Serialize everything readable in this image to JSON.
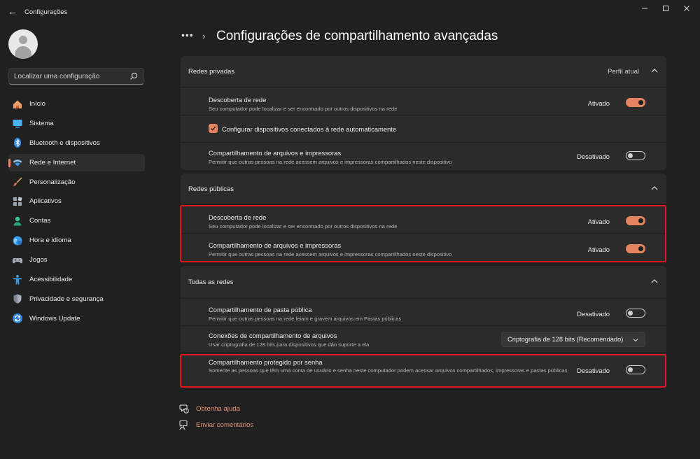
{
  "window": {
    "title": "Configurações",
    "back_label": "←",
    "controls": [
      "minimize",
      "maximize",
      "close"
    ]
  },
  "search": {
    "placeholder": "Localizar uma configuração"
  },
  "sidebar": {
    "items": [
      {
        "label": "Início",
        "icon": "home-icon"
      },
      {
        "label": "Sistema",
        "icon": "system-icon"
      },
      {
        "label": "Bluetooth e dispositivos",
        "icon": "bluetooth-icon"
      },
      {
        "label": "Rede e Internet",
        "icon": "wifi-icon",
        "active": true
      },
      {
        "label": "Personalização",
        "icon": "brush-icon"
      },
      {
        "label": "Aplicativos",
        "icon": "apps-icon"
      },
      {
        "label": "Contas",
        "icon": "account-icon"
      },
      {
        "label": "Hora e idioma",
        "icon": "globe-icon"
      },
      {
        "label": "Jogos",
        "icon": "gamepad-icon"
      },
      {
        "label": "Acessibilidade",
        "icon": "accessibility-icon"
      },
      {
        "label": "Privacidade e segurança",
        "icon": "shield-icon"
      },
      {
        "label": "Windows Update",
        "icon": "update-icon"
      }
    ]
  },
  "header": {
    "dots": "•••",
    "chevron": "›",
    "title": "Configurações de compartilhamento avançadas"
  },
  "private_networks": {
    "title": "Redes privadas",
    "profile": "Perfil atual",
    "network_discovery": {
      "title": "Descoberta de rede",
      "desc": "Seu computador pode localizar e ser encontrado por outros dispositivos na rede",
      "status": "Ativado"
    },
    "auto_setup": {
      "label": "Configurar dispositivos conectados à rede automaticamente",
      "checked": true
    },
    "file_printer_sharing": {
      "title": "Compartilhamento de arquivos e impressoras",
      "desc": "Permitir que outras pessoas na rede acessem arquivos e impressoras compartilhados neste dispositivo",
      "status": "Desativado"
    }
  },
  "public_networks": {
    "title": "Redes públicas",
    "network_discovery": {
      "title": "Descoberta de rede",
      "desc": "Seu computador pode localizar e ser encontrado por outros dispositivos na rede",
      "status": "Ativado"
    },
    "file_printer_sharing": {
      "title": "Compartilhamento de arquivos e impressoras",
      "desc": "Permitir que outras pessoas na rede acessem arquivos e impressoras compartilhados neste dispositivo",
      "status": "Ativado"
    }
  },
  "all_networks": {
    "title": "Todas as redes",
    "public_folder": {
      "title": "Compartilhamento de pasta pública",
      "desc": "Permitir que outras pessoas na rede leiam e gravem arquivos em Pastas públicas",
      "status": "Desativado"
    },
    "file_connections": {
      "title": "Conexões de compartilhamento de arquivos",
      "desc": "Usar criptografia de 128 bits para dispositivos que dão suporte a ela",
      "selected": "Criptografia de 128 bits (Recomendado)"
    },
    "password_protected": {
      "title": "Compartilhamento protegido por senha",
      "desc": "Somente as pessoas que têm uma conta de usuário e senha neste computador podem acessar arquivos compartilhados, impressoras e pastas públicas",
      "status": "Desativado"
    }
  },
  "footer": {
    "help": "Obtenha ajuda",
    "feedback": "Enviar comentários"
  },
  "colors": {
    "accent": "#e4835f",
    "link": "#e69575",
    "highlight": "#e0181e",
    "background": "#202020",
    "card": "#2b2b2b"
  }
}
